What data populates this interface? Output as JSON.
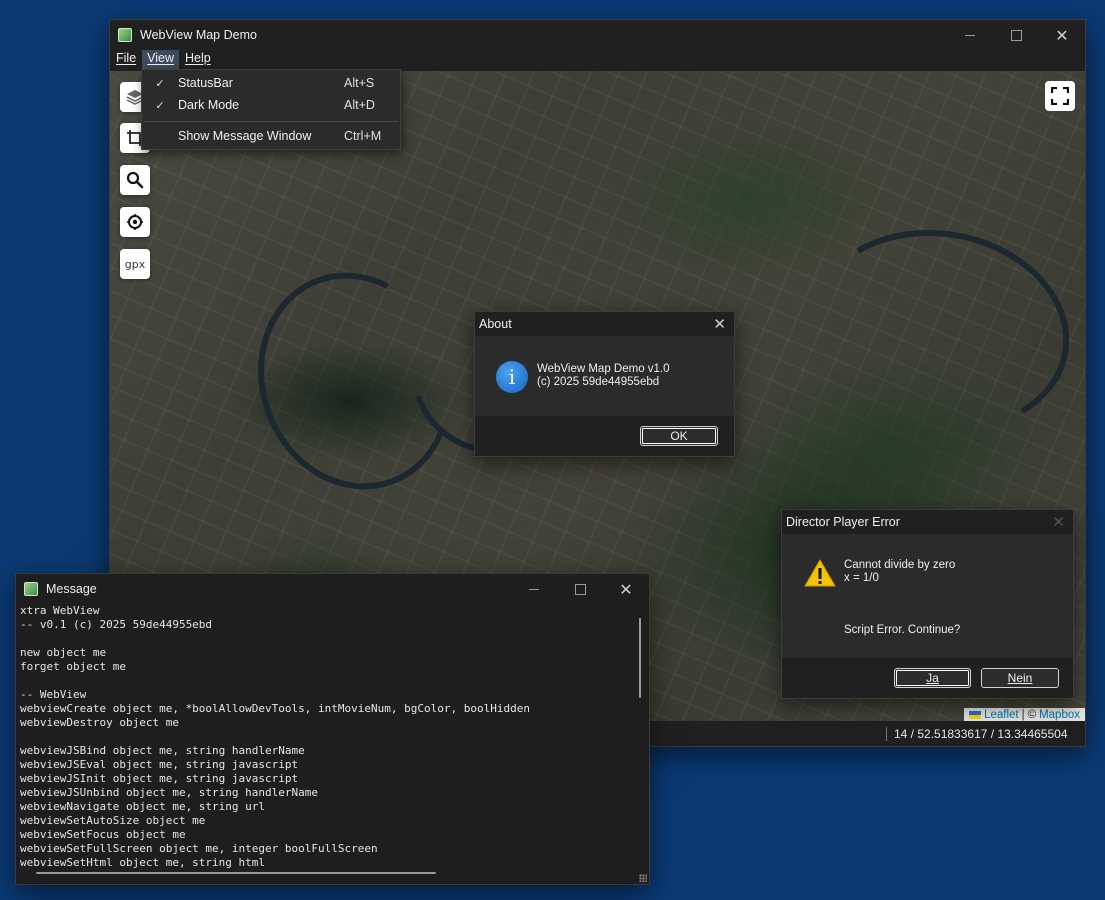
{
  "main_window": {
    "title": "WebView Map Demo",
    "icon": "map-app-icon",
    "menu": [
      {
        "label": "File",
        "active": false
      },
      {
        "label": "View",
        "active": true
      },
      {
        "label": "Help",
        "active": false
      }
    ],
    "map": {
      "controls": {
        "layers_icon": "layers-icon",
        "crop_icon": "crop-icon",
        "search_icon": "search-icon",
        "locate_icon": "locate-icon",
        "gpx_label": "gpx",
        "fullscreen_icon": "fullscreen-icon"
      },
      "attribution": {
        "leaflet": "Leaflet",
        "separator": "|",
        "copyright": "©",
        "mapbox": "Mapbox"
      }
    },
    "statusbar": {
      "text": "14 / 52.51833617 / 13.34465504"
    }
  },
  "view_menu": {
    "items": [
      {
        "label": "StatusBar",
        "shortcut": "Alt+S",
        "checked": true
      },
      {
        "label": "Dark Mode",
        "shortcut": "Alt+D",
        "checked": true
      },
      {
        "label": "Show Message Window",
        "shortcut": "Ctrl+M",
        "checked": false
      }
    ],
    "check_glyph": "✓"
  },
  "about_dialog": {
    "title": "About",
    "icon": "info-icon",
    "icon_glyph": "i",
    "line1": "WebView Map Demo v1.0",
    "line2": "(c) 2025 59de44955ebd",
    "ok_label": "OK"
  },
  "error_dialog": {
    "title": "Director Player Error",
    "icon": "warning-icon",
    "line1": "Cannot divide by zero",
    "line2": "x = 1/0",
    "question": "Script Error. Continue?",
    "yes_label": "Ja",
    "no_label": "Nein"
  },
  "message_window": {
    "title": "Message",
    "lines": [
      "xtra WebView",
      "-- v0.1 (c) 2025 59de44955ebd",
      "",
      "new object me",
      "forget object me",
      "",
      "-- WebView",
      "webviewCreate object me, *boolAllowDevTools, intMovieNum, bgColor, boolHidden",
      "webviewDestroy object me",
      "",
      "webviewJSBind object me, string handlerName",
      "webviewJSEval object me, string javascript",
      "webviewJSInit object me, string javascript",
      "webviewJSUnbind object me, string handlerName",
      "webviewNavigate object me, string url",
      "webviewSetAutoSize object me",
      "webviewSetFocus object me",
      "webviewSetFullScreen object me, integer boolFullScreen",
      "webviewSetHtml object me, string html"
    ]
  },
  "colors": {
    "desktop": "#0b3a75",
    "window_bg": "#202020",
    "link": "#0078a8"
  }
}
